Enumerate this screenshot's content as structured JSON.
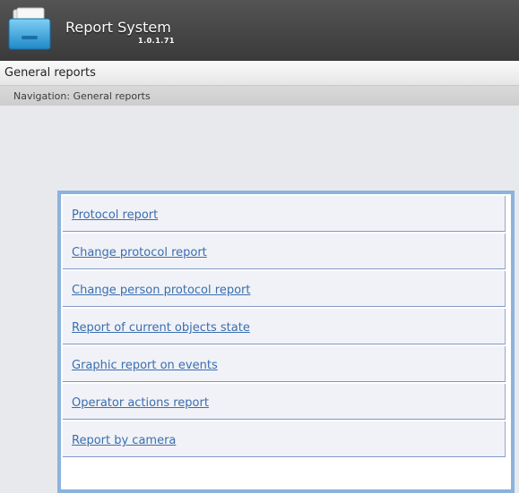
{
  "app": {
    "title": "Report System",
    "version": "1.0.1.71",
    "logo_icon": "folder-icon"
  },
  "page": {
    "title": "General reports"
  },
  "navigation": {
    "text": "Navigation: General reports"
  },
  "reports": [
    {
      "label": "Protocol report"
    },
    {
      "label": "Change protocol report"
    },
    {
      "label": "Change person protocol report"
    },
    {
      "label": "Report of current objects state"
    },
    {
      "label": "Graphic report on events"
    },
    {
      "label": "Operator actions report"
    },
    {
      "label": "Report by camera"
    }
  ],
  "colors": {
    "header_bg": "#454545",
    "link": "#3a6eae",
    "panel_border": "#8cb2de",
    "item_bg": "#f1f2f7",
    "page_bg": "#e8e9ed"
  }
}
